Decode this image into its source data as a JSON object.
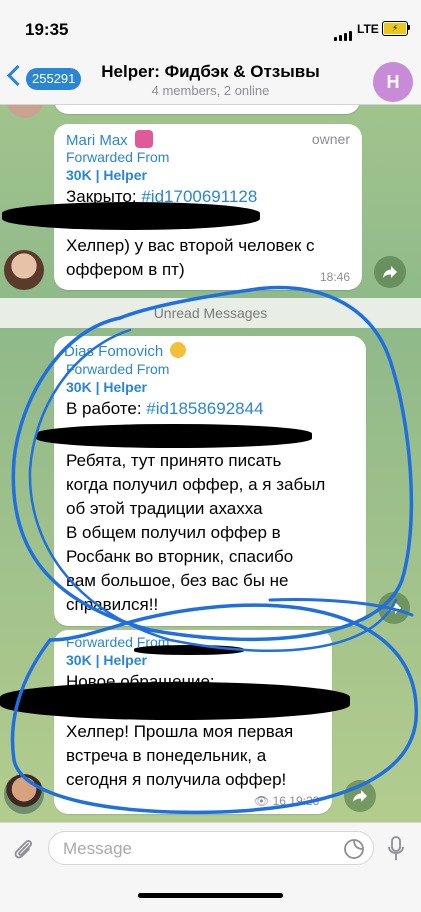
{
  "status_bar": {
    "time": "19:35",
    "network": "LTE"
  },
  "header": {
    "back_count": "255291",
    "title": "Helper: Фидбэк & Отзывы",
    "subtitle": "4 members, 2 online",
    "avatar_letter": "H"
  },
  "messages": [
    {
      "sender": "Mari Max",
      "role": "owner",
      "forwarded_label": "Forwarded From",
      "forwarded_source": "30K | Helper",
      "status_prefix": "Закрыто: ",
      "ticket": "#id1700691128",
      "lines": [
        "Хелпер) у вас второй человек с",
        "оффером в пт)"
      ],
      "time": "18:46"
    },
    {
      "sender": "Dias Fomovich",
      "forwarded_label": "Forwarded From",
      "forwarded_source": "30K | Helper",
      "status_prefix": "В работе: ",
      "ticket": "#id1858692844",
      "lines": [
        "Ребята, тут принято писать",
        "когда получил оффер, а я забыл",
        "об этой традиции ахахха",
        "В общем получил оффер в",
        "Росбанк во вторник, спасибо",
        "вам большое, без вас бы не",
        "справился!!"
      ]
    },
    {
      "forwarded_label": "Forwarded From",
      "forwarded_source": "30K | Helper",
      "status_prefix": "Новое обращение:",
      "lines": [
        "Хелпер! Прошла моя первая",
        "встреча в понедельник, а",
        "сегодня я получила оффер!"
      ],
      "views": "16",
      "time": "19:23"
    }
  ],
  "unread_separator": "Unread Messages",
  "input": {
    "placeholder": "Message"
  },
  "colors": {
    "accent": "#2a86d4",
    "scribble": "#1f6fe0"
  }
}
